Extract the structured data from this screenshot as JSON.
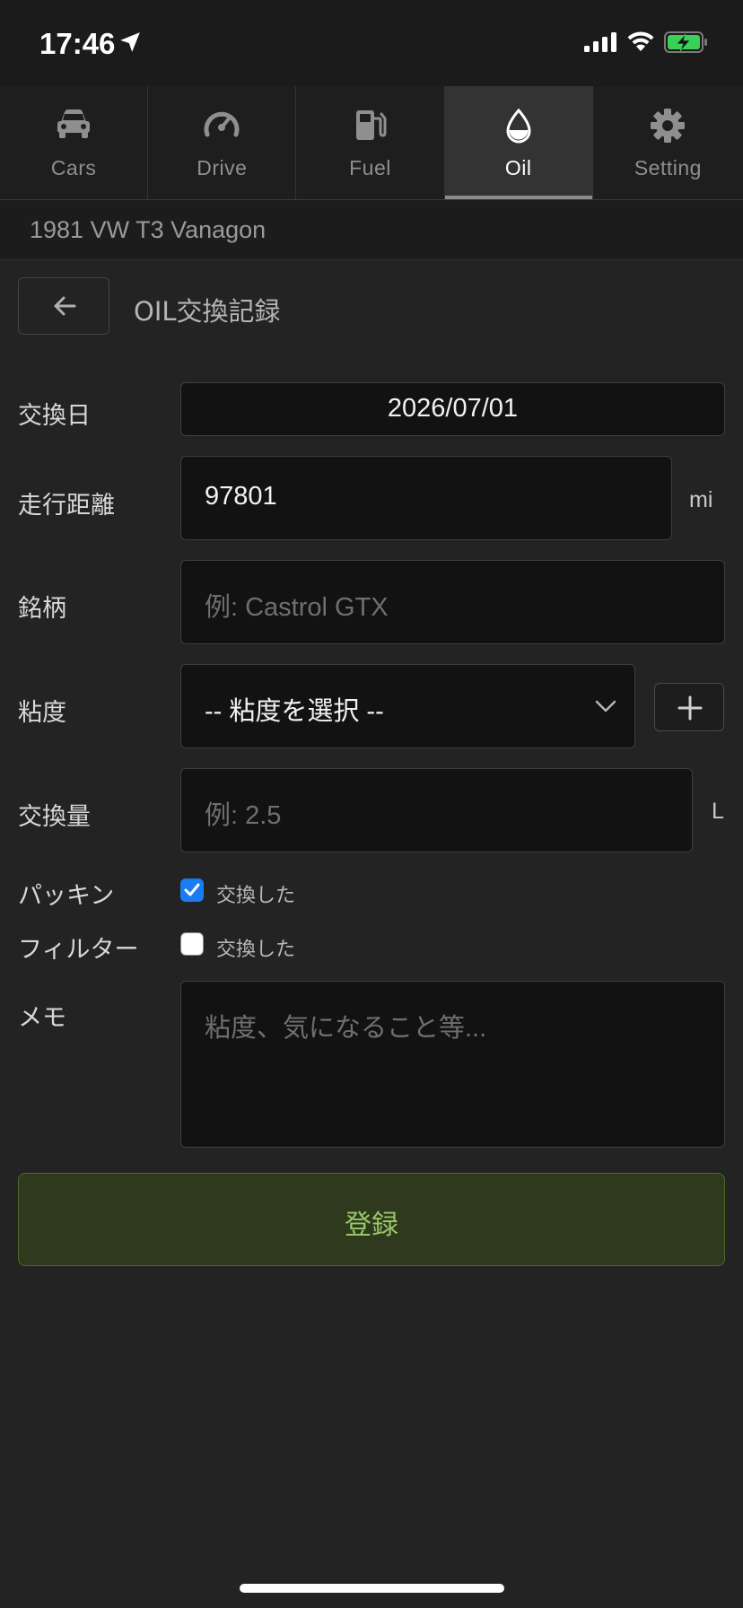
{
  "status_bar": {
    "time": "17:46"
  },
  "tabs": [
    {
      "label": "Cars",
      "icon": "car-icon",
      "active": false
    },
    {
      "label": "Drive",
      "icon": "speedometer-icon",
      "active": false
    },
    {
      "label": "Fuel",
      "icon": "fuel-pump-icon",
      "active": false
    },
    {
      "label": "Oil",
      "icon": "oil-drop-icon",
      "active": true
    },
    {
      "label": "Setting",
      "icon": "gear-icon",
      "active": false
    }
  ],
  "car_name": "1981 VW T3 Vanagon",
  "header": {
    "title": "OIL交換記録"
  },
  "form": {
    "date": {
      "label": "交換日",
      "value": "2026/07/01"
    },
    "mileage": {
      "label": "走行距離",
      "value": "97801",
      "unit": "mi"
    },
    "brand": {
      "label": "銘柄",
      "placeholder": "例: Castrol GTX"
    },
    "viscosity": {
      "label": "粘度",
      "selected": "-- 粘度を選択 --"
    },
    "amount": {
      "label": "交換量",
      "placeholder": "例: 2.5",
      "unit": "L"
    },
    "gasket": {
      "label": "パッキン",
      "checkbox_label": "交換した",
      "checked": true
    },
    "filter": {
      "label": "フィルター",
      "checkbox_label": "交換した",
      "checked": false
    },
    "memo": {
      "label": "メモ",
      "placeholder": "粘度、気になること等..."
    }
  },
  "submit_label": "登録",
  "colors": {
    "accent_blue": "#1a7cf5",
    "submit_bg": "#2f391d",
    "submit_text": "#9ac66a"
  }
}
